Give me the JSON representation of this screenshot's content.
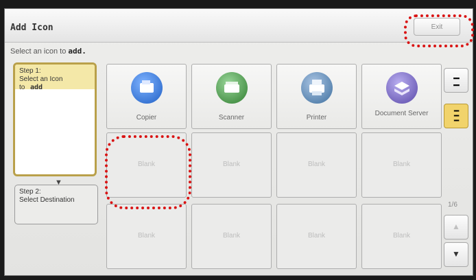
{
  "screen": {
    "title": "Add Icon",
    "exit_label": "Exit",
    "instruction_prefix": "Select an icon to",
    "instruction_action": "add."
  },
  "steps": {
    "step1_title": "Step 1:",
    "step1_line1": "Select an Icon",
    "step1_line2": "to",
    "step1_bold": "add",
    "step2_title": "Step 2:",
    "step2_line1": "Select Destination"
  },
  "tiles": [
    {
      "label": "Copier",
      "icon": "copier-icon",
      "color": "#2c6fd0"
    },
    {
      "label": "Scanner",
      "icon": "scanner-icon",
      "color": "#3a8a3a"
    },
    {
      "label": "Printer",
      "icon": "printer-icon",
      "color": "#4a78a8"
    },
    {
      "label": "Document Server",
      "icon": "document-server-icon",
      "color": "#6a5ab5"
    },
    {
      "label": "Blank"
    },
    {
      "label": "Blank"
    },
    {
      "label": "Blank"
    },
    {
      "label": "Blank"
    },
    {
      "label": "Blank"
    },
    {
      "label": "Blank"
    },
    {
      "label": "Blank"
    },
    {
      "label": "Blank"
    }
  ],
  "pager": {
    "page_indicator": "1/6",
    "view_small_icon": "small-grid-icon",
    "view_large_icon": "large-grid-icon",
    "up_icon": "up-arrow-icon",
    "down_icon": "down-arrow-icon"
  },
  "colors": {
    "highlight": "#d91414",
    "selected_step": "#f4e8a8",
    "active_view": "#f1d36b"
  }
}
